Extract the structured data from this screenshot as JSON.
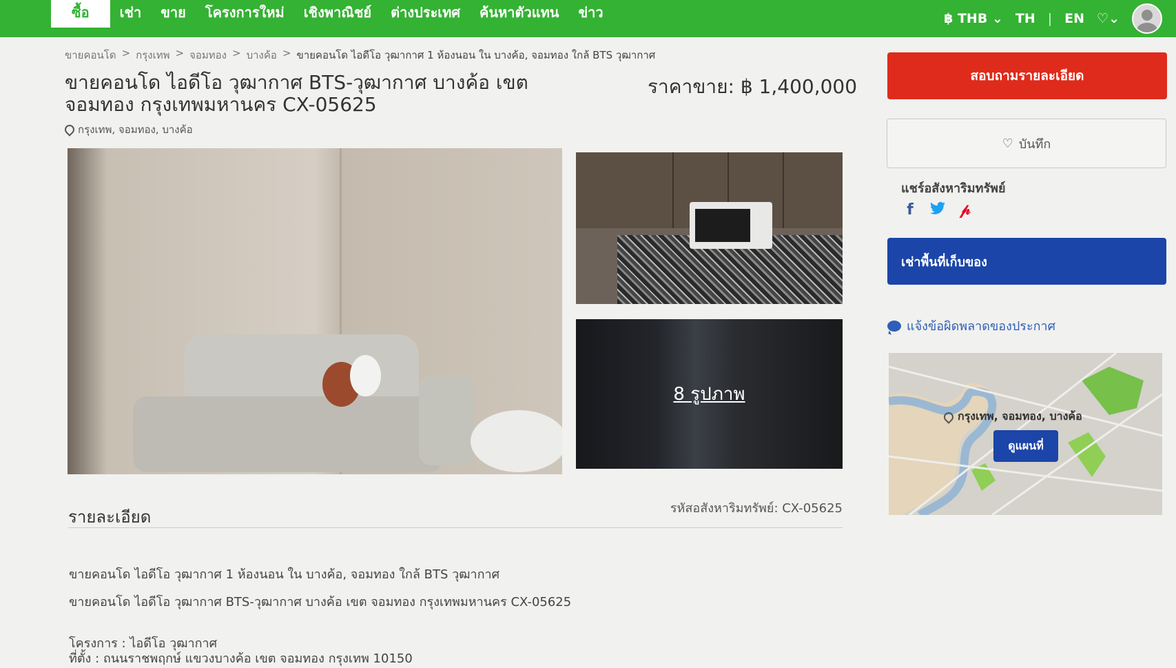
{
  "nav": {
    "items": [
      "ซื้อ",
      "เช่า",
      "ขาย",
      "โครงการใหม่",
      "เชิงพาณิชย์",
      "ต่างประเทศ",
      "ค้นหาตัวแทน",
      "ข่าว"
    ],
    "currency": "฿ THB",
    "lang_th": "TH",
    "lang_sep": "|",
    "lang_en": "EN",
    "favorites_icon": "heart-icon"
  },
  "breadcrumb": [
    "ขายคอนโด",
    "กรุงเทพ",
    "จอมทอง",
    "บางค้อ"
  ],
  "breadcrumb_sep": ">",
  "breadcrumb_current": "ขายคอนโด ไอดีโอ วุฒากาศ 1 ห้องนอน ใน บางค้อ, จอมทอง ใกล้ BTS วุฒากาศ",
  "listing": {
    "title": "ขายคอนโด ไอดีโอ วุฒากาศ BTS-วุฒากาศ บางค้อ เขต จอมทอง กรุงเทพมหานคร CX-05625",
    "price": "ราคาขาย: ฿ 1,400,000",
    "location": "กรุงเทพ, จอมทอง, บางค้อ",
    "photo_count": "8 รูปภาพ"
  },
  "details": {
    "heading": "รายละเอียด",
    "property_code": "รหัสอสังหาริมทรัพย์: CX-05625",
    "line1": "ขายคอนโด ไอดีโอ วุฒากาศ 1 ห้องนอน ใน บางค้อ, จอมทอง ใกล้ BTS วุฒากาศ",
    "line2": "ขายคอนโด ไอดีโอ วุฒากาศ BTS-วุฒากาศ บางค้อ เขต จอมทอง กรุงเทพมหานคร CX-05625",
    "line3": "โครงการ : ไอดีโอ วุฒากาศ",
    "line4": "ที่ตั้ง : ถนนราชพฤกษ์ แขวงบางค้อ เขต จอมทอง กรุงเทพ 10150"
  },
  "sidebar": {
    "inquire_label": "สอบถามรายละเอียด",
    "save_label": "บันทึก",
    "share_label": "แชร์อสังหาริมทรัพย์",
    "storage_label": "เช่าพื้นที่เก็บของ",
    "report_label": "แจ้งข้อผิดพลาดของประกาศ",
    "map_location": "กรุงเทพ, จอมทอง, บางค้อ",
    "map_button": "ดูแผนที่"
  },
  "colors": {
    "brand_green": "#34b233",
    "inquire_red": "#df2b1b",
    "primary_blue": "#1b45a8",
    "link_blue": "#2f5fb8"
  }
}
